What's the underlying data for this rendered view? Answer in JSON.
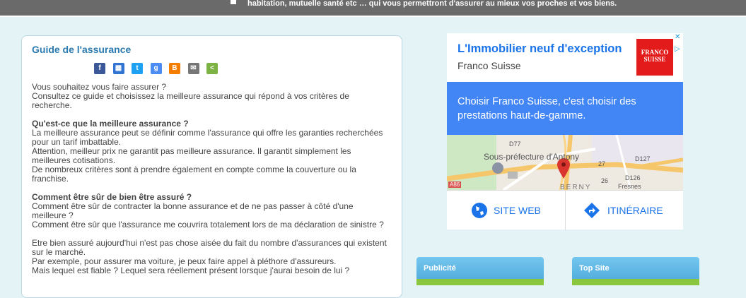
{
  "topbar": {
    "text": "habitation, mutuelle santé etc … qui vous permettront d'assurer au mieux vos proches et vos biens."
  },
  "guide": {
    "title": "Guide de l'assurance",
    "share_icons": [
      {
        "name": "facebook-icon",
        "glyph": "f",
        "color": "#3b5998"
      },
      {
        "name": "delicious-icon",
        "glyph": "▦",
        "color": "#3274d1"
      },
      {
        "name": "twitter-icon",
        "glyph": "t",
        "color": "#1da1f2"
      },
      {
        "name": "google-icon",
        "glyph": "g",
        "color": "#4b8bf4"
      },
      {
        "name": "blogger-icon",
        "glyph": "B",
        "color": "#f57d00"
      },
      {
        "name": "email-icon",
        "glyph": "✉",
        "color": "#777777"
      },
      {
        "name": "share-icon",
        "glyph": "<",
        "color": "#7cb342"
      }
    ],
    "intro": [
      "Vous souhaitez vous faire assurer ?",
      "Consultez ce guide et choisissez la meilleure assurance qui répond à vos critères de recherche."
    ],
    "sections": [
      {
        "heading": "Qu'est-ce que la meilleure assurance ?",
        "lines": [
          "La meilleure assurance peut se définir comme l'assurance qui offre les garanties recherchées pour un tarif imbattable.",
          "Attention, meilleur prix ne garantit pas meilleure assurance. Il garantit simplement les meilleures cotisations.",
          "De nombreux critères sont à prendre également en compte comme la couverture ou la franchise."
        ]
      },
      {
        "heading": "Comment être sûr de bien être assuré ?",
        "lines": [
          "Comment être sûr de contracter la bonne assurance et de ne pas passer à côté d'une meilleure ?",
          "Comment être sûr que l'assurance me couvrira totalement lors de ma déclaration de sinistre ?"
        ]
      }
    ],
    "outro": [
      "Etre bien assuré aujourd'hui n'est pas chose aisée du fait du nombre d'assurances qui existent sur le marché.",
      "Par exemple, pour assurer ma voiture, je peux faire appel à pléthore d'assureurs.",
      "Mais lequel est fiable ? Lequel sera réellement présent lorsque j'aurai besoin de lui ?"
    ]
  },
  "ad": {
    "title": "L'Immobilier neuf d'exception",
    "advertiser": "Franco Suisse",
    "logo_text": "FRANCO SUISSE",
    "description": "Choisir Franco Suisse, c'est choisir des prestations haut-de-gamme.",
    "map_labels": [
      "Sous-préfecture d'Antony",
      "D77",
      "D127",
      "D126",
      "27",
      "26",
      "A86",
      "Fresnes",
      "BERNY"
    ],
    "buttons": [
      {
        "label": "SITE WEB",
        "icon": "globe-icon"
      },
      {
        "label": "ITINÉRAIRE",
        "icon": "directions-icon"
      }
    ]
  },
  "widgets": [
    {
      "title": "Publicité"
    },
    {
      "title": "Top Site"
    }
  ]
}
